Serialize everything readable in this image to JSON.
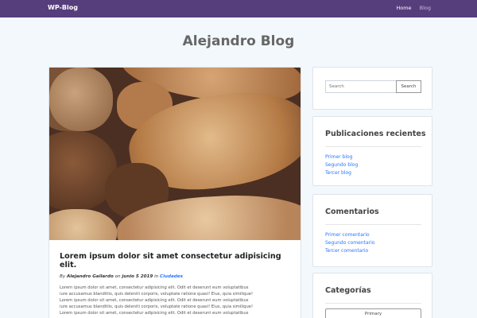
{
  "navbar": {
    "brand": "WP-Blog",
    "links": [
      "Home",
      "Blog"
    ]
  },
  "page": {
    "title": "Alejandro Blog"
  },
  "post": {
    "title": "Lorem ipsum dolor sit amet consectetur adipisicing elit.",
    "by": "By",
    "author": "Alejandro Gallardo",
    "on": "on",
    "date": "junio 5 2019",
    "in": "in",
    "category": "Ciudades",
    "lines": [
      "Lorem ipsum dolor sit amet, consectetur adipisicing elit. Odit et deserunt eum voluptatibus",
      "iure accusamus blanditiis, quis deleniti corporis, voluptate ratione quasi! Eius, quia similique!",
      "Lorem ipsum dolor sit amet, consectetur adipisicing elit. Odit et deserunt eum voluptatibus",
      "iure accusamus blanditiis, quis deleniti corporis, voluptate ratione quasi! Eius, quia similique!",
      "Lorem ipsum dolor sit amet, consectetur adipisicing elit. Odit et deserunt eum voluptatibus"
    ]
  },
  "sidebar": {
    "search": {
      "placeholder": "Search",
      "button": "Search"
    },
    "recent": {
      "title": "Publicaciones recientes",
      "items": [
        "Primer blog",
        "Segundo blog",
        "Tercer blog"
      ]
    },
    "comments": {
      "title": "Comentarios",
      "items": [
        "Primer comentario",
        "Segundo comentario",
        "Tercer comentario"
      ]
    },
    "categories": {
      "title": "Categorías",
      "button": "Primary"
    }
  }
}
